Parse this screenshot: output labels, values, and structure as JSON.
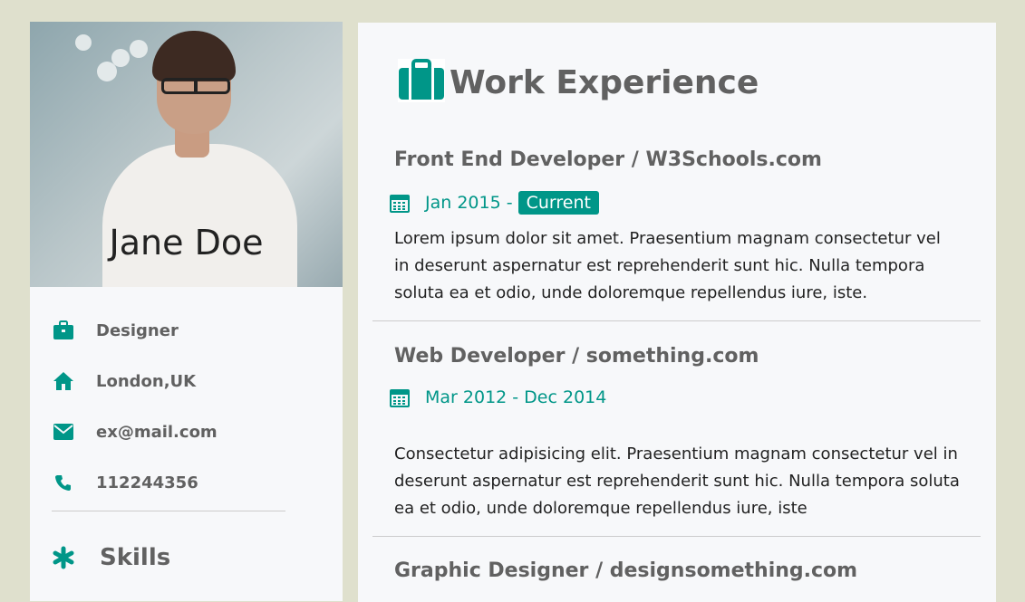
{
  "profile": {
    "name": "Jane Doe",
    "info": [
      {
        "icon": "briefcase-icon",
        "text": "Designer"
      },
      {
        "icon": "home-icon",
        "text": "London,UK"
      },
      {
        "icon": "envelope-icon",
        "text": "ex@mail.com"
      },
      {
        "icon": "phone-icon",
        "text": "112244356"
      }
    ],
    "skills_heading": "Skills"
  },
  "work": {
    "heading": "Work Experience",
    "jobs": [
      {
        "title": "Front End Developer / W3Schools.com",
        "date": "Jan 2015 -",
        "badge": "Current",
        "description": "Lorem ipsum dolor sit amet. Praesentium magnam consectetur vel in deserunt aspernatur est reprehenderit sunt hic. Nulla tempora soluta ea et odio, unde doloremque repellendus iure, iste."
      },
      {
        "title": "Web Developer / something.com",
        "date": "Mar 2012 - Dec 2014",
        "description": "Consectetur adipisicing elit. Praesentium magnam consectetur vel in deserunt aspernatur est reprehenderit sunt hic. Nulla tempora soluta ea et odio, unde doloremque repellendus iure, iste"
      },
      {
        "title": "Graphic Designer / designsomething.com"
      }
    ]
  },
  "colors": {
    "page_background": "#dfe0cd",
    "panel_background": "#f7f8fa",
    "accent": "#009688",
    "heading_text": "#616161",
    "body_text": "#222222"
  }
}
